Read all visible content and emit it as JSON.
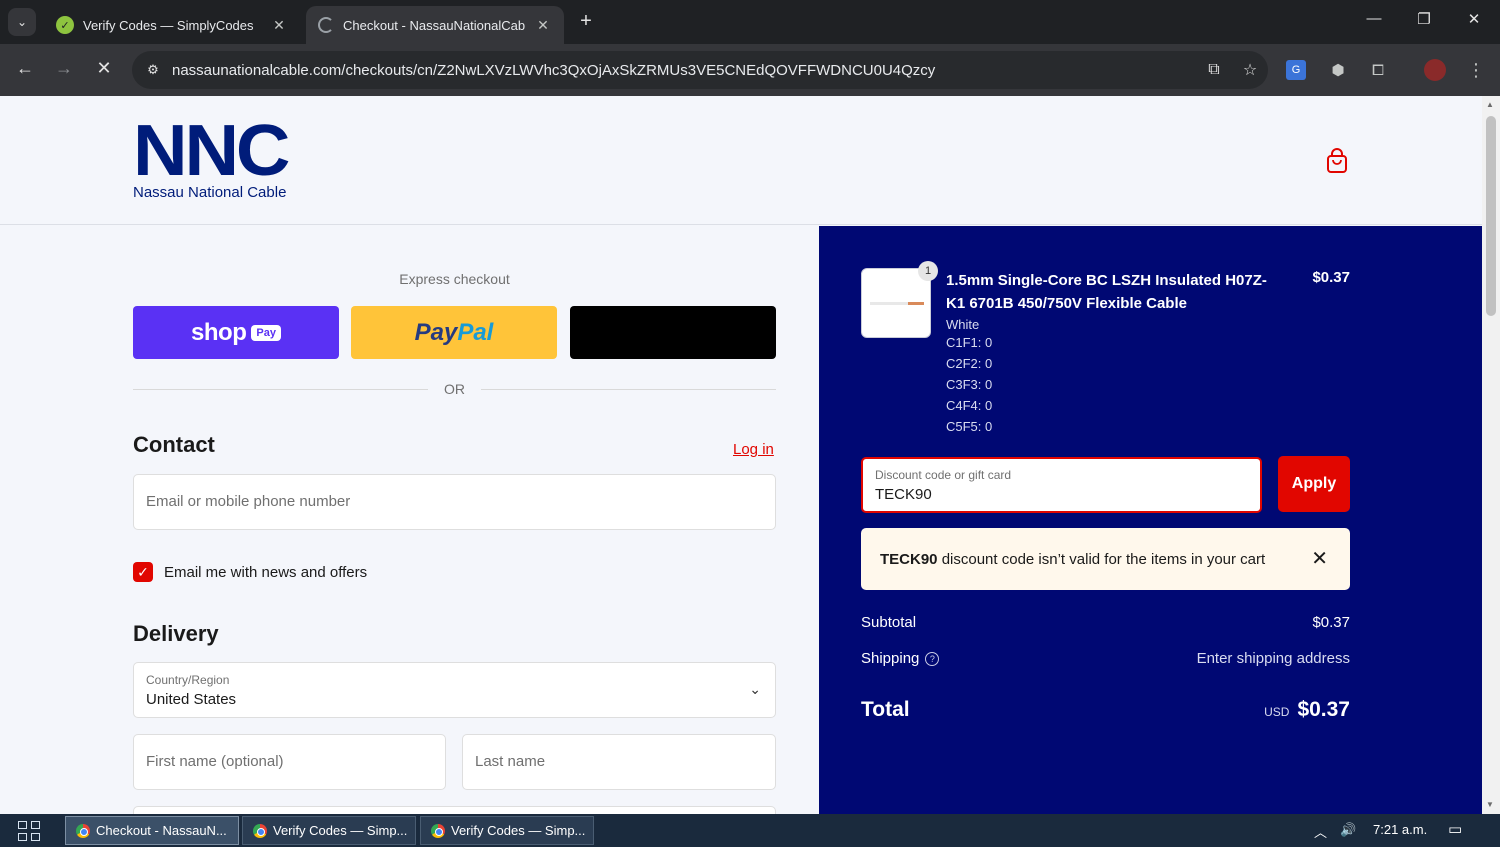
{
  "browser": {
    "tabs": [
      {
        "title": "Verify Codes — SimplyCodes",
        "active": false
      },
      {
        "title": "Checkout - NassauNationalCab",
        "active": true
      }
    ],
    "url": "nassaunationalcable.com/checkouts/cn/Z2NwLXVzLWVhc3QxOjAxSkZRMUs3VE5CNEdQOVFFWDNCU0U4Qzcy"
  },
  "header": {
    "logo_mark": "NNC",
    "logo_text": "Nassau National Cable"
  },
  "express": {
    "label": "Express checkout",
    "shop_word": "shop",
    "shop_pill": "Pay",
    "paypal_a": "Pay",
    "paypal_b": "Pal",
    "or": "OR"
  },
  "contact": {
    "heading": "Contact",
    "login": "Log in",
    "email_placeholder": "Email or mobile phone number",
    "newsletter_label": "Email me with news and offers",
    "newsletter_checked": true
  },
  "delivery": {
    "heading": "Delivery",
    "country_label": "Country/Region",
    "country_value": "United States",
    "first_name_placeholder": "First name (optional)",
    "last_name_placeholder": "Last name"
  },
  "order": {
    "item": {
      "quantity": "1",
      "title": "1.5mm Single-Core BC LSZH Insulated H07Z-K1 6701B 450/750V Flexible Cable",
      "price": "$0.37",
      "variants": [
        "White",
        "C1F1: 0",
        "C2F2: 0",
        "C3F3: 0",
        "C4F4: 0",
        "C5F5: 0"
      ]
    },
    "discount": {
      "label": "Discount code or gift card",
      "value": "TECK90",
      "apply": "Apply",
      "error_code": "TECK90",
      "error_text": " discount code isn’t valid for the items in your cart"
    },
    "subtotal_label": "Subtotal",
    "subtotal_value": "$0.37",
    "shipping_label": "Shipping",
    "shipping_value": "Enter shipping address",
    "total_label": "Total",
    "total_currency": "USD",
    "total_value": "$0.37"
  },
  "taskbar": {
    "items": [
      "Checkout - NassauN...",
      "Verify Codes — Simp...",
      "Verify Codes — Simp..."
    ],
    "time": "7:21 a.m."
  },
  "colors": {
    "brand_navy": "#001c7a",
    "summary_bg": "#000873",
    "accent_red": "#e10600",
    "shop_purple": "#5a31f4",
    "paypal_yellow": "#ffc439"
  }
}
